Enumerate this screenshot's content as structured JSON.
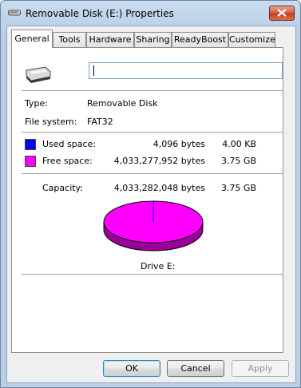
{
  "window": {
    "title": "Removable Disk (E:) Properties"
  },
  "tabs": [
    {
      "label": "General",
      "active": true
    },
    {
      "label": "Tools",
      "active": false
    },
    {
      "label": "Hardware",
      "active": false
    },
    {
      "label": "Sharing",
      "active": false
    },
    {
      "label": "ReadyBoost",
      "active": false
    },
    {
      "label": "Customize",
      "active": false
    }
  ],
  "general": {
    "name_value": "",
    "type_label": "Type:",
    "type_value": "Removable Disk",
    "fs_label": "File system:",
    "fs_value": "FAT32",
    "used_label": "Used space:",
    "used_bytes": "4,096 bytes",
    "used_size": "4.00 KB",
    "free_label": "Free space:",
    "free_bytes": "4,033,277,952 bytes",
    "free_size": "3.75 GB",
    "capacity_label": "Capacity:",
    "capacity_bytes": "4,033,282,048 bytes",
    "capacity_size": "3.75 GB",
    "drive_label": "Drive E:"
  },
  "colors": {
    "used": "#0000ff",
    "free": "#ff00ff",
    "free_side": "#9c009c"
  },
  "icons": {
    "title": "removable-drive-icon",
    "drive": "removable-drive-icon",
    "close": "close-icon"
  },
  "buttons": {
    "ok": "OK",
    "cancel": "Cancel",
    "apply": "Apply"
  }
}
